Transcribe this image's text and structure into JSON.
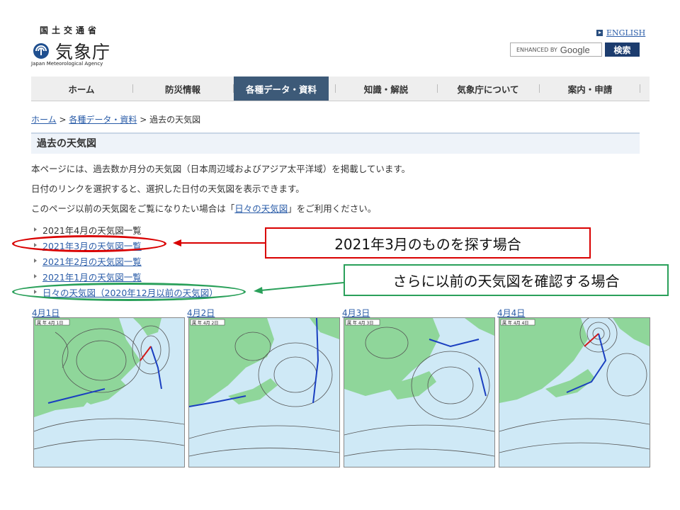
{
  "header": {
    "gov_name": "国土交通省",
    "agency_name": "気象庁",
    "agency_en": "Japan Meteorological Agency",
    "english_link": "ENGLISH",
    "search_placeholder": "ENHANCED BY",
    "search_brand": "Google",
    "search_button": "検索"
  },
  "nav": {
    "items": [
      {
        "label": "ホーム"
      },
      {
        "label": "防災情報"
      },
      {
        "label": "各種データ・資料"
      },
      {
        "label": "知識・解説"
      },
      {
        "label": "気象庁について"
      },
      {
        "label": "案内・申請"
      }
    ],
    "active_index": 2,
    "active_color": "#3d5a78"
  },
  "breadcrumb": {
    "home": "ホーム",
    "sep": ">",
    "data": "各種データ・資料",
    "current": "過去の天気図"
  },
  "page": {
    "title": "過去の天気図",
    "para1": "本ページには、過去数か月分の天気図（日本周辺域およびアジア太平洋域）を掲載しています。",
    "para2": "日付のリンクを選択すると、選択した日付の天気図を表示できます。",
    "para3_before": "このページ以前の天気図をご覧になりたい場合は「",
    "para3_link": "日々の天気図",
    "para3_after": "」をご利用ください。"
  },
  "month_list": [
    {
      "label": "2021年4月の天気図一覧",
      "linked": false
    },
    {
      "label": "2021年3月の天気図一覧",
      "linked": true
    },
    {
      "label": "2021年2月の天気図一覧",
      "linked": true
    },
    {
      "label": "2021年1月の天気図一覧",
      "linked": true
    },
    {
      "label": "日々の天気図（2020年12月以前の天気図）",
      "linked": true
    }
  ],
  "maps": [
    {
      "date": "4月1日",
      "stamp": "属 年 4月 1日"
    },
    {
      "date": "4月2日",
      "stamp": "属 年 4月 2日"
    },
    {
      "date": "4月3日",
      "stamp": "属 年 4月 3日"
    },
    {
      "date": "4月4日",
      "stamp": "属 年 4月 4日"
    }
  ],
  "annotations": {
    "red_text": "2021年3月のものを探す場合",
    "green_text": "さらに以前の天気図を確認する場合",
    "red_color": "#d90000",
    "green_color": "#2aa05a"
  },
  "colors": {
    "link": "#2a5ca8",
    "land": "#8fd69a",
    "sea": "#cfe9f6"
  }
}
